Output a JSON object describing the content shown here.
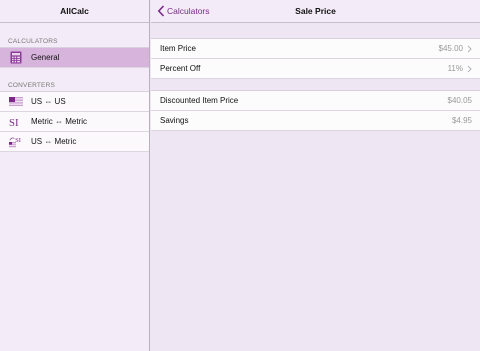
{
  "sidebar": {
    "title": "AllCalc",
    "sections": [
      {
        "header": "CALCULATORS",
        "items": [
          {
            "label": "General",
            "icon": "calculator-icon",
            "selected": true
          }
        ]
      },
      {
        "header": "CONVERTERS",
        "items": [
          {
            "label": "US ⇔ US",
            "icon": "us-flag-icon"
          },
          {
            "label": "Metric ⇔ Metric",
            "icon": "si-icon"
          },
          {
            "label": "US ⇔ Metric",
            "icon": "us-si-icon"
          }
        ]
      }
    ]
  },
  "main": {
    "back_label": "Calculators",
    "title": "Sale Price",
    "inputs": [
      {
        "label": "Item Price",
        "value": "$45.00"
      },
      {
        "label": "Percent Off",
        "value": "11%"
      }
    ],
    "results": [
      {
        "label": "Discounted Item Price",
        "value": "$40.05"
      },
      {
        "label": "Savings",
        "value": "$4.95"
      }
    ]
  },
  "colors": {
    "accent": "#7a2a86",
    "selected_bg": "#d7b4dc",
    "background": "#efe6f4"
  }
}
